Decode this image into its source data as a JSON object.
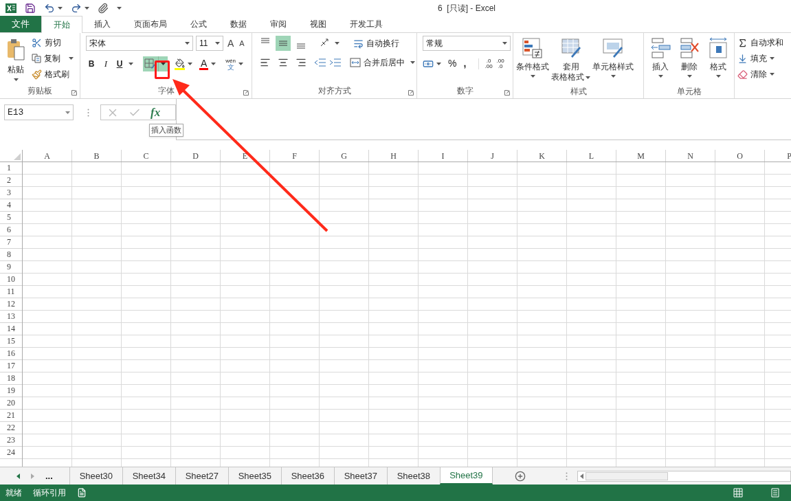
{
  "window": {
    "title": "6  [只读] - Excel"
  },
  "file_tab": "文件",
  "tabs": [
    {
      "label": "开始",
      "selected": true
    },
    {
      "label": "插入",
      "selected": false
    },
    {
      "label": "页面布局",
      "selected": false
    },
    {
      "label": "公式",
      "selected": false
    },
    {
      "label": "数据",
      "selected": false
    },
    {
      "label": "审阅",
      "selected": false
    },
    {
      "label": "视图",
      "selected": false
    },
    {
      "label": "开发工具",
      "selected": false
    }
  ],
  "clipboard": {
    "paste": "粘贴",
    "cut": "剪切",
    "copy": "复制",
    "format_painter": "格式刷",
    "label": "剪贴板"
  },
  "font": {
    "name": "宋体",
    "size": "11",
    "grow": "A",
    "shrink": "A",
    "bold": "B",
    "italic": "I",
    "underline": "U",
    "border_highlighted": true,
    "font_color": "A",
    "phonetic_top": "wén",
    "phonetic_bottom": "文",
    "label": "字体"
  },
  "alignment": {
    "vertical": [
      {
        "selected": false
      },
      {
        "selected": true
      },
      {
        "selected": false
      }
    ],
    "wrap": "自动换行",
    "merge": "合并后居中",
    "label": "对齐方式"
  },
  "number": {
    "format": "常规",
    "percent": "%",
    "comma": ",",
    "increase_decimal": [
      ".0",
      ".00"
    ],
    "decrease_decimal": [
      ".00",
      ".0"
    ],
    "label": "数字"
  },
  "styles": {
    "conditional": "条件格式",
    "table": [
      "套用",
      "表格格式"
    ],
    "cell_styles": "单元格样式",
    "label": "样式"
  },
  "cells": {
    "insert": "插入",
    "delete": "删除",
    "format": "格式",
    "label": "单元格"
  },
  "editing": {
    "autosum": "自动求和",
    "fill": "填充",
    "clear": "清除"
  },
  "name_box": "E13",
  "fx": "fx",
  "tooltip": "插入函数",
  "columns": [
    "A",
    "B",
    "C",
    "D",
    "E",
    "F",
    "G",
    "H",
    "I",
    "J",
    "K",
    "L",
    "M",
    "N",
    "O",
    "P"
  ],
  "rows": [
    "1",
    "2",
    "3",
    "4",
    "5",
    "6",
    "7",
    "8",
    "9",
    "10",
    "11",
    "12",
    "13",
    "14",
    "15",
    "16",
    "17",
    "18",
    "19",
    "20",
    "21",
    "22",
    "23",
    "24"
  ],
  "more_sheets": "...",
  "sheet_tabs": [
    {
      "label": "Sheet30",
      "selected": false
    },
    {
      "label": "Sheet34",
      "selected": false
    },
    {
      "label": "Sheet27",
      "selected": false
    },
    {
      "label": "Sheet35",
      "selected": false
    },
    {
      "label": "Sheet36",
      "selected": false
    },
    {
      "label": "Sheet37",
      "selected": false
    },
    {
      "label": "Sheet38",
      "selected": false
    },
    {
      "label": "Sheet39",
      "selected": true
    }
  ],
  "status": [
    "就绪",
    "循环引用"
  ]
}
